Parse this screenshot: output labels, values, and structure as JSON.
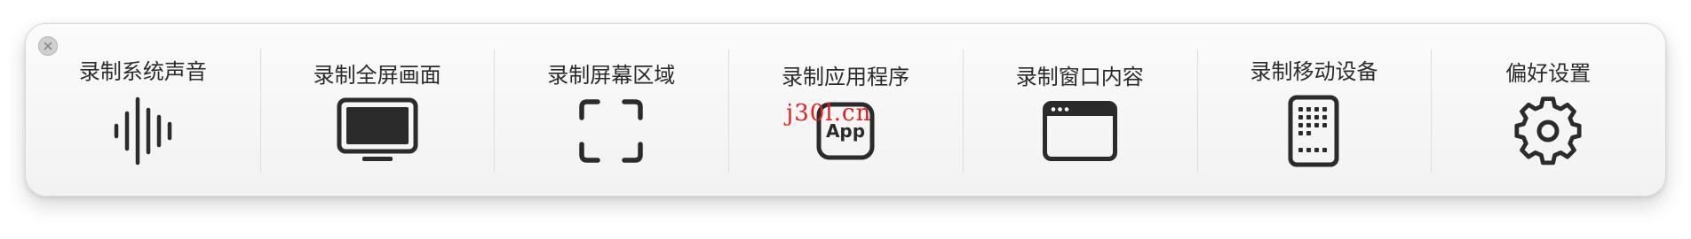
{
  "toolbar": {
    "close_icon": "close-x-icon",
    "items": [
      {
        "label": "录制系统声音",
        "icon": "waveform-icon"
      },
      {
        "label": "录制全屏画面",
        "icon": "display-icon"
      },
      {
        "label": "录制屏幕区域",
        "icon": "selection-frame-icon"
      },
      {
        "label": "录制应用程序",
        "icon": "app-icon",
        "icon_text": "App",
        "watermark": "j30l.cn"
      },
      {
        "label": "录制窗口内容",
        "icon": "browser-window-icon"
      },
      {
        "label": "录制移动设备",
        "icon": "phone-icon"
      },
      {
        "label": "偏好设置",
        "icon": "gear-icon"
      }
    ]
  },
  "colors": {
    "icon": "#2b2b2b",
    "label": "#2b2b2b",
    "watermark": "#e0211c"
  }
}
